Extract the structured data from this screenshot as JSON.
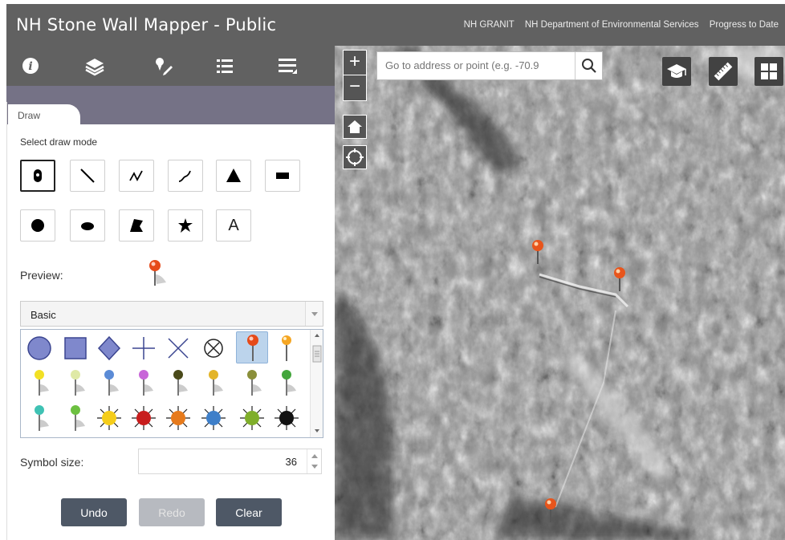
{
  "header": {
    "title": "NH Stone Wall Mapper - Public",
    "links": [
      "NH GRANIT",
      "NH Department of Environmental Services",
      "Progress to Date"
    ]
  },
  "toolbar": {
    "icons": [
      "info-icon",
      "layers-icon",
      "draw-icon",
      "legend-icon",
      "menu-icon"
    ]
  },
  "panel": {
    "tab_label": "Draw",
    "select_mode_label": "Select draw mode",
    "preview_label": "Preview:",
    "symbol_set": "Basic",
    "symbol_size_label": "Symbol size:",
    "symbol_size_value": "36",
    "text_mode_label": "A",
    "undo_label": "Undo",
    "redo_label": "Redo",
    "clear_label": "Clear"
  },
  "map": {
    "search_placeholder": "Go to address or point (e.g. -70.9",
    "zoom_in": "+",
    "zoom_out": "−",
    "accent": "#e86a1f"
  }
}
